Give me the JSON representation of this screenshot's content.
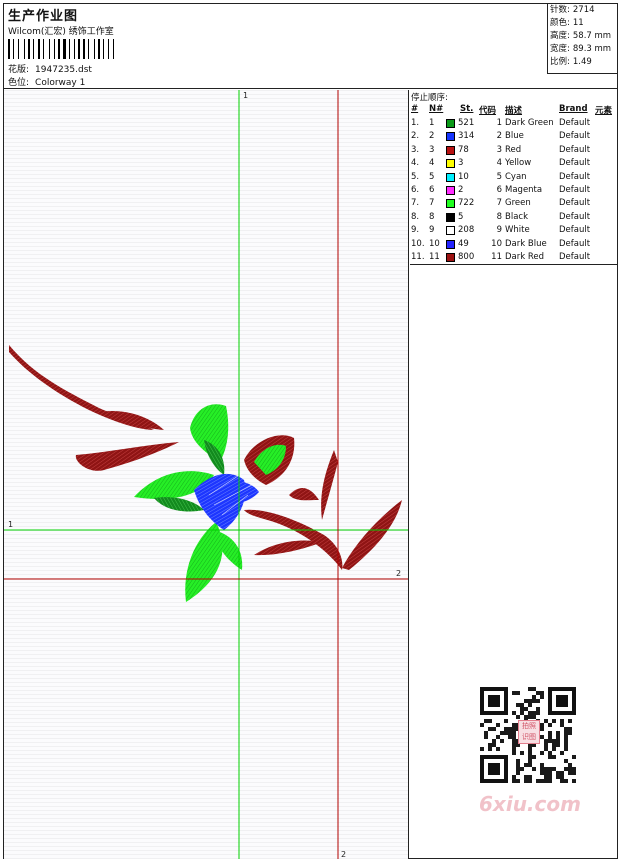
{
  "header": {
    "title": "生产作业图",
    "company": "Wilcom(汇宏) 绣饰工作室",
    "design_label": "花版:",
    "design_value": "1947235.dst",
    "colorway_label": "色位:",
    "colorway_value": "Colorway 1"
  },
  "specs": [
    {
      "label": "针数:",
      "value": "2714"
    },
    {
      "label": "颜色:",
      "value": "11"
    },
    {
      "label": "高度:",
      "value": "58.7 mm"
    },
    {
      "label": "宽度:",
      "value": "89.3 mm"
    },
    {
      "label": "比例:",
      "value": "1.49"
    }
  ],
  "guides": {
    "v1": "1",
    "h1": "1",
    "h2": "2",
    "v2": "2",
    "green_color": "#00d000",
    "red_color": "#b00000"
  },
  "legend": {
    "title": "停止顺序:",
    "headers": {
      "index": "#",
      "needle": "N#",
      "stitches": "St.",
      "code": "代码",
      "description": "描述",
      "brand": "Brand",
      "element": "元素"
    },
    "rows": [
      {
        "index": "1.",
        "needle": "1",
        "color": "#0a9a18",
        "stitches": "521",
        "code": "1",
        "description": "Dark Green",
        "brand": "Default"
      },
      {
        "index": "2.",
        "needle": "2",
        "color": "#1535ff",
        "stitches": "314",
        "code": "2",
        "description": "Blue",
        "brand": "Default"
      },
      {
        "index": "3.",
        "needle": "3",
        "color": "#b81212",
        "stitches": "78",
        "code": "3",
        "description": "Red",
        "brand": "Default"
      },
      {
        "index": "4.",
        "needle": "4",
        "color": "#ffff00",
        "stitches": "3",
        "code": "4",
        "description": "Yellow",
        "brand": "Default"
      },
      {
        "index": "5.",
        "needle": "5",
        "color": "#00f0ff",
        "stitches": "10",
        "code": "5",
        "description": "Cyan",
        "brand": "Default"
      },
      {
        "index": "6.",
        "needle": "6",
        "color": "#ff2bff",
        "stitches": "2",
        "code": "6",
        "description": "Magenta",
        "brand": "Default"
      },
      {
        "index": "7.",
        "needle": "7",
        "color": "#20ff20",
        "stitches": "722",
        "code": "7",
        "description": "Green",
        "brand": "Default"
      },
      {
        "index": "8.",
        "needle": "8",
        "color": "#000000",
        "stitches": "5",
        "code": "8",
        "description": "Black",
        "brand": "Default"
      },
      {
        "index": "9.",
        "needle": "9",
        "color": "#ffffff",
        "stitches": "208",
        "code": "9",
        "description": "White",
        "brand": "Default"
      },
      {
        "index": "10.",
        "needle": "10",
        "color": "#2323ff",
        "stitches": "49",
        "code": "10",
        "description": "Dark Blue",
        "brand": "Default"
      },
      {
        "index": "11.",
        "needle": "11",
        "color": "#9c1212",
        "stitches": "800",
        "code": "11",
        "description": "Dark Red",
        "brand": "Default"
      }
    ]
  },
  "watermark": {
    "text": "6xiu.com",
    "seal_text": "拍照识图"
  }
}
